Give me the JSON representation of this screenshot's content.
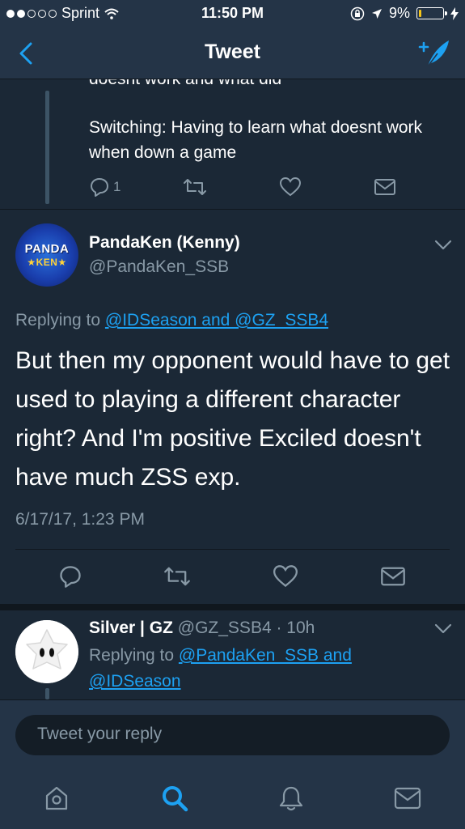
{
  "status": {
    "carrier": "Sprint",
    "time": "11:50 PM",
    "battery": "9%",
    "battery_level": 0.09
  },
  "nav": {
    "title": "Tweet"
  },
  "prev_tweet": {
    "partial_line": "doesnt work and what did",
    "text": "Switching: Having to learn what doesnt work when down a game",
    "reply_count": "1"
  },
  "main_tweet": {
    "avatar_line1": "PANDA",
    "avatar_line2": "★KEN★",
    "name": "PandaKen (Kenny)",
    "handle": "@PandaKen_SSB",
    "replying_prefix": "Replying to",
    "replying_to": "@IDSeason and @GZ_SSB4",
    "text": "But then my opponent would have to get used to playing a different character right? And I'm positive Exciled doesn't have much ZSS exp.",
    "timestamp": "6/17/17, 1:23 PM"
  },
  "reply_tweet": {
    "name": "Silver | GZ",
    "handle_time": "@GZ_SSB4 · 10h",
    "replying_prefix": "Replying to",
    "replying_to_1": "@PandaKen_SSB and",
    "replying_to_2": "@IDSeason"
  },
  "reply_bar": {
    "placeholder": "Tweet your reply"
  },
  "tabs": [
    "home-icon",
    "search-icon",
    "notifications-icon",
    "messages-icon"
  ],
  "colors": {
    "accent": "#1da1f2",
    "background": "#1b2836",
    "bar": "#243447",
    "muted": "#8899a6"
  }
}
